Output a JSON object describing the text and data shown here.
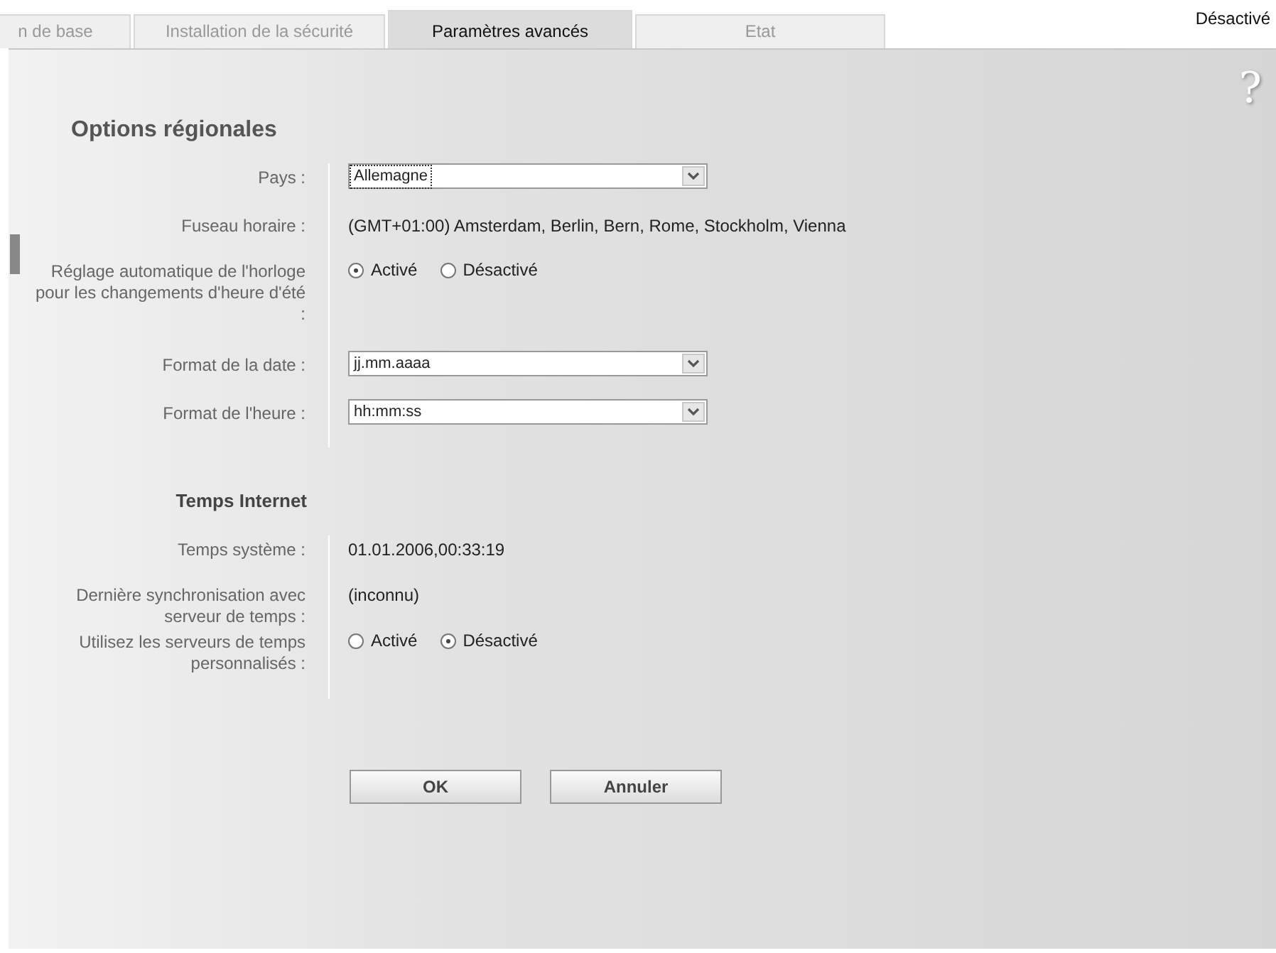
{
  "tabs": [
    {
      "label": "n de base",
      "selected": false
    },
    {
      "label": "Installation de la sécurité",
      "selected": false
    },
    {
      "label": "Paramètres avancés",
      "selected": true
    },
    {
      "label": "Etat",
      "selected": false
    }
  ],
  "status": "Désactivé",
  "help": "?",
  "heading": "Options régionales",
  "groups": [
    {
      "rows": [
        {
          "kind": "select",
          "label": "Pays :",
          "value": "Allemagne",
          "focused": true
        },
        {
          "kind": "text",
          "label": "Fuseau horaire :",
          "value": "(GMT+01:00) Amsterdam, Berlin, Bern, Rome, Stockholm, Vienna"
        },
        {
          "kind": "radio",
          "label": "Réglage automatique de l'horloge pour les changements d'heure d'été :",
          "options": [
            {
              "label": "Activé",
              "selected": true
            },
            {
              "label": "Désactivé",
              "selected": false
            }
          ]
        },
        {
          "kind": "select",
          "label": "Format de la date :",
          "value": "jj.mm.aaaa",
          "focused": false
        },
        {
          "kind": "select",
          "label": "Format de l'heure :",
          "value": "hh:mm:ss",
          "focused": false
        }
      ]
    },
    {
      "title": "Temps Internet",
      "rows": [
        {
          "kind": "text",
          "label": "Temps système :",
          "value": "01.01.2006,00:33:19"
        },
        {
          "kind": "text",
          "label": "Dernière synchronisation avec serveur de temps :",
          "value": "(inconnu)"
        },
        {
          "kind": "radio",
          "label": "Utilisez les serveurs de temps personnalisés :",
          "options": [
            {
              "label": "Activé",
              "selected": false
            },
            {
              "label": "Désactivé",
              "selected": true
            }
          ]
        }
      ]
    }
  ],
  "buttons": [
    "OK",
    "Annuler"
  ]
}
